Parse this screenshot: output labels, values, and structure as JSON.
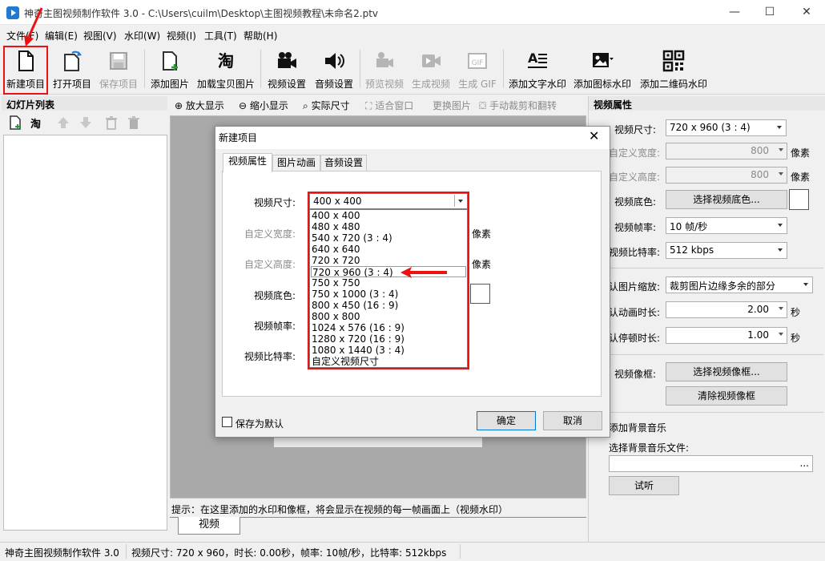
{
  "window": {
    "title": "神奇主图视频制作软件 3.0 - C:\\Users\\cuilm\\Desktop\\主图视频教程\\未命名2.ptv",
    "minimize": "—",
    "maximize": "☐",
    "close": "✕"
  },
  "menu": [
    "文件(F)",
    "编辑(E)",
    "视图(V)",
    "水印(W)",
    "视频(I)",
    "工具(T)",
    "帮助(H)"
  ],
  "toolbar": [
    {
      "label": "新建项目",
      "icon": "new-file-icon",
      "enabled": true
    },
    {
      "label": "打开项目",
      "icon": "open-file-icon",
      "enabled": true
    },
    {
      "label": "保存项目",
      "icon": "save-icon",
      "enabled": false
    },
    {
      "label": "添加图片",
      "icon": "add-image-icon",
      "enabled": true
    },
    {
      "label": "加载宝贝图片",
      "icon": "taobao-icon",
      "enabled": true
    },
    {
      "label": "视频设置",
      "icon": "video-camera-icon",
      "enabled": true
    },
    {
      "label": "音频设置",
      "icon": "speaker-icon",
      "enabled": true
    },
    {
      "label": "预览视频",
      "icon": "preview-camera-icon",
      "enabled": false
    },
    {
      "label": "生成视频",
      "icon": "play-icon",
      "enabled": false
    },
    {
      "label": "生成 GIF",
      "icon": "gif-icon",
      "enabled": false
    },
    {
      "label": "添加文字水印",
      "icon": "text-watermark-icon",
      "enabled": true
    },
    {
      "label": "添加图标水印",
      "icon": "image-watermark-icon",
      "enabled": true
    },
    {
      "label": "添加二维码水印",
      "icon": "qrcode-icon",
      "enabled": true
    }
  ],
  "left_panel": {
    "title": "幻灯片列表",
    "taobao": "淘"
  },
  "center_tools": [
    "放大显示",
    "缩小显示",
    "实际尺寸",
    "适合窗口",
    "更换图片",
    "手动裁剪和翻转"
  ],
  "hint": "提示：在这里添加的水印和像框，将会显示在视频的每一帧画面上（视频水印）",
  "center_tab": "视频",
  "right_panel": {
    "title": "视频属性",
    "size_label": "视频尺寸:",
    "size_value": "720 x 960   (3 : 4)",
    "width_label": "自定义宽度:",
    "width_value": "800",
    "height_label": "自定义高度:",
    "height_value": "800",
    "pixel_unit": "像素",
    "bg_label": "视频底色:",
    "bg_button": "选择视频底色...",
    "fps_label": "视频帧率:",
    "fps_value": "10 帧/秒",
    "bitrate_label": "视频比特率:",
    "bitrate_value": "512 kbps",
    "scale_label": "认图片缩放:",
    "scale_value": "裁剪图片边缘多余的部分",
    "anim_label": "认动画时长:",
    "anim_value": "2.00",
    "pause_label": "认停顿时长:",
    "pause_value": "1.00",
    "sec_unit": "秒",
    "frame_label": "视频像框:",
    "frame_button": "选择视频像框...",
    "clear_frame_button": "清除视频像框",
    "bgm_label": "添加背景音乐",
    "bgm_file_label": "选择背景音乐文件:",
    "bgm_browse": "...",
    "listen_button": "试听"
  },
  "status": {
    "app": "神奇主图视频制作软件 3.0",
    "info": "视频尺寸: 720 x 960，时长: 0.00秒，帧率: 10帧/秒，比特率: 512kbps"
  },
  "dialog": {
    "title": "新建项目",
    "close": "✕",
    "tabs": [
      "视频属性",
      "图片动画",
      "音频设置"
    ],
    "size_label": "视频尺寸:",
    "size_value": "400 x 400",
    "width_label": "自定义宽度:",
    "height_label": "自定义高度:",
    "pixel_unit": "像素",
    "bg_label": "视频底色:",
    "fps_label": "视频帧率:",
    "bitrate_label": "视频比特率:",
    "options": [
      "400 x 400",
      "480 x 480",
      "540 x 720   (3 : 4)",
      "640 x 640",
      "720 x 720",
      "720 x 960   (3 : 4)",
      "750 x 750",
      "750 x 1000   (3 : 4)",
      "800 x 450   (16 : 9)",
      "800 x 800",
      "1024 x 576   (16 : 9)",
      "1280 x 720   (16 : 9)",
      "1080 x 1440   (3 : 4)",
      "自定义视频尺寸"
    ],
    "save_default": "保存为默认",
    "ok": "确定",
    "cancel": "取消"
  }
}
